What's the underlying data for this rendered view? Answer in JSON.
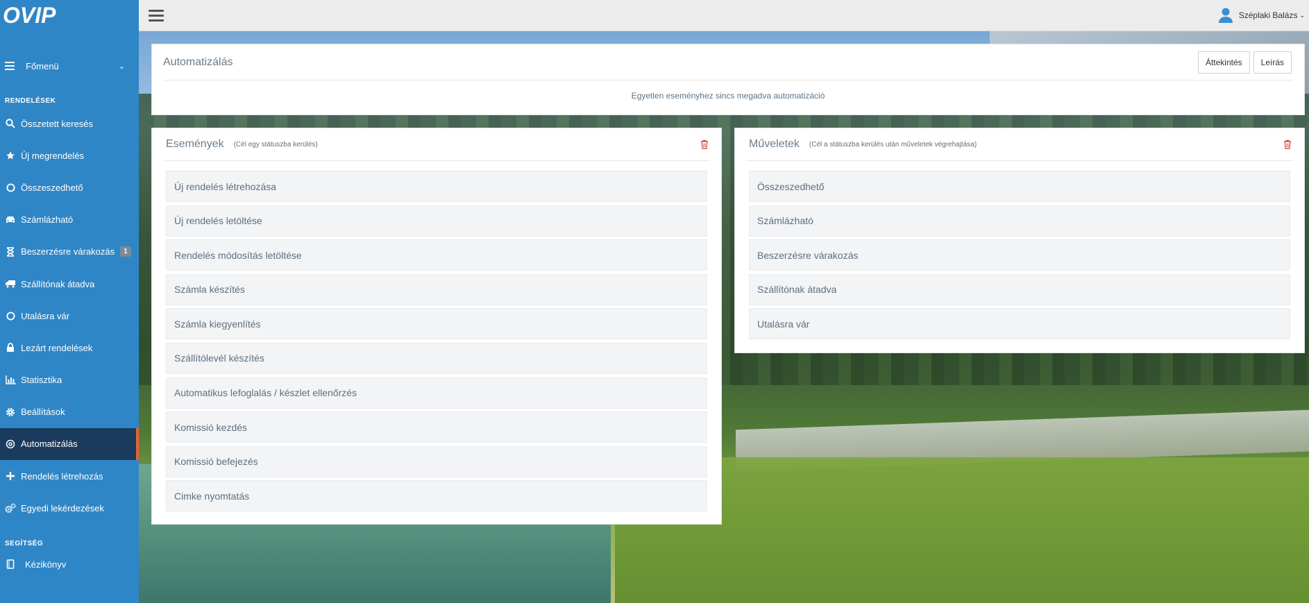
{
  "sidebar": {
    "logo_text": "OVIP",
    "menu_label": "Főmenü",
    "sections": {
      "rendelesek": "RENDELÉSEK",
      "segitseg": "SEGÍTSÉG"
    },
    "items": [
      {
        "label": "Összetett keresés",
        "icon": "search-icon"
      },
      {
        "label": "Új megrendelés",
        "icon": "star-icon"
      },
      {
        "label": "Összeszedhető",
        "icon": "circle-icon"
      },
      {
        "label": "Számlázható",
        "icon": "car-icon"
      },
      {
        "label": "Beszerzésre várakozás",
        "icon": "hourglass-icon",
        "badge": "1"
      },
      {
        "label": "Szállítónak átadva",
        "icon": "truck-icon"
      },
      {
        "label": "Utalásra vár",
        "icon": "circle-icon"
      },
      {
        "label": "Lezárt rendelések",
        "icon": "lock-icon"
      },
      {
        "label": "Statisztika",
        "icon": "bar-chart-icon"
      },
      {
        "label": "Beállítások",
        "icon": "gear-icon"
      },
      {
        "label": "Automatizálás",
        "icon": "automation-icon",
        "active": true
      },
      {
        "label": "Rendelés létrehozás",
        "icon": "plus-icon"
      },
      {
        "label": "Egyedi lekérdezések",
        "icon": "gears-icon"
      }
    ],
    "help_items": [
      {
        "label": "Kézikönyv",
        "icon": "book-icon"
      }
    ],
    "colors": {
      "bg": "#2f86c6",
      "active_bg": "#1a3b5e",
      "active_accent": "#e8603c"
    }
  },
  "topbar": {
    "user_name": "Széplaki Balázs"
  },
  "automation": {
    "title": "Automatizálás",
    "overview_button": "Áttekintés",
    "description_button": "Leírás",
    "empty_message": "Egyetlen eseményhez sincs megadva automatizáció"
  },
  "events": {
    "title": "Események",
    "subtitle": "(Cél egy státuszba kerülés)",
    "items": [
      "Új rendelés létrehozása",
      "Új rendelés letöltése",
      "Rendelés módosítás letöltése",
      "Számla készítés",
      "Számla kiegyenlítés",
      "Szállítólevél készítés",
      "Automatikus lefoglalás / készlet ellenőrzés",
      "Komissió kezdés",
      "Komissió befejezés",
      "Cimke nyomtatás"
    ]
  },
  "operations": {
    "title": "Műveletek",
    "subtitle": "(Cél a státuszba kerülés után műveletek végrehajtása)",
    "items": [
      "Összeszedhető",
      "Számlázható",
      "Beszerzésre várakozás",
      "Szállítónak átadva",
      "Utalásra vár"
    ]
  }
}
